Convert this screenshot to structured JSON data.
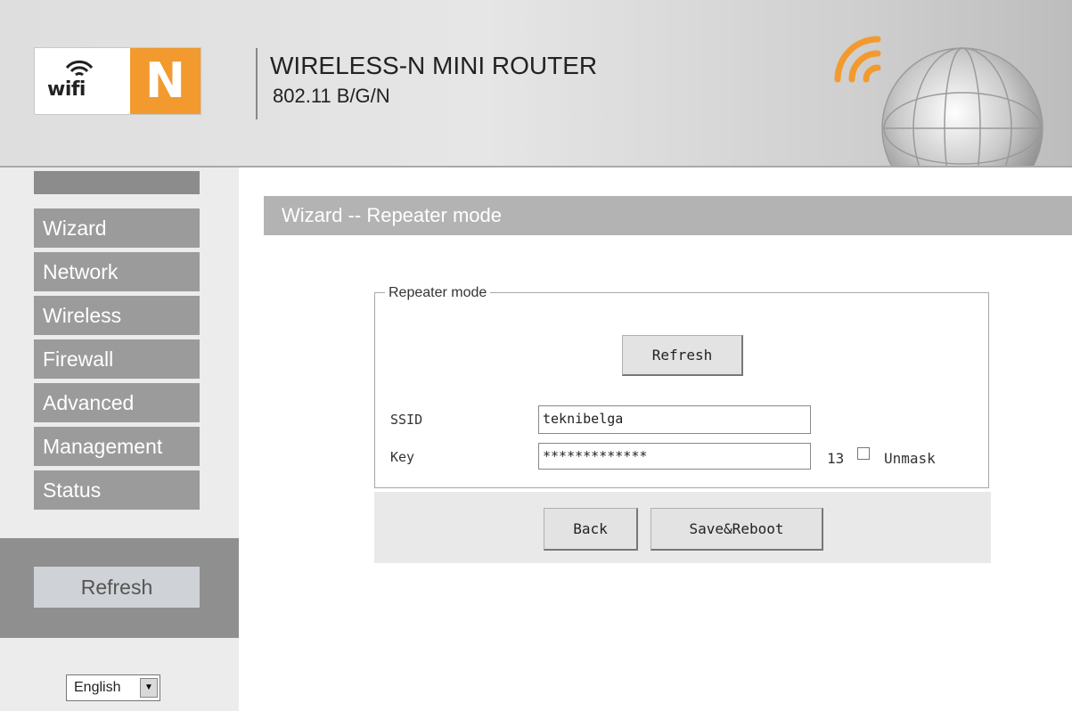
{
  "header": {
    "logo_wifi": "wifi",
    "logo_n": "N",
    "title": "WIRELESS-N MINI ROUTER",
    "subtitle": "802.11 B/G/N"
  },
  "sidebar": {
    "items": [
      {
        "label": "Wizard"
      },
      {
        "label": "Network"
      },
      {
        "label": "Wireless"
      },
      {
        "label": "Firewall"
      },
      {
        "label": "Advanced"
      },
      {
        "label": "Management"
      },
      {
        "label": "Status"
      }
    ],
    "refresh_label": "Refresh",
    "language": "English"
  },
  "main": {
    "section_title": "Wizard -- Repeater mode",
    "fieldset_legend": "Repeater mode",
    "refresh_label": "Refresh",
    "ssid_label": "SSID",
    "ssid_value": "teknibelga",
    "key_label": "Key",
    "key_value": "*************",
    "key_length": "13",
    "unmask_label": "Unmask",
    "back_label": "Back",
    "save_label": "Save&Reboot"
  },
  "colors": {
    "accent_orange": "#f29a2e",
    "menu_gray": "#9b9b9b",
    "section_bar_gray": "#b3b3b3"
  },
  "icons": [
    "wifi-icon",
    "globe-signal-icon",
    "dropdown-arrow-icon",
    "checkbox"
  ]
}
